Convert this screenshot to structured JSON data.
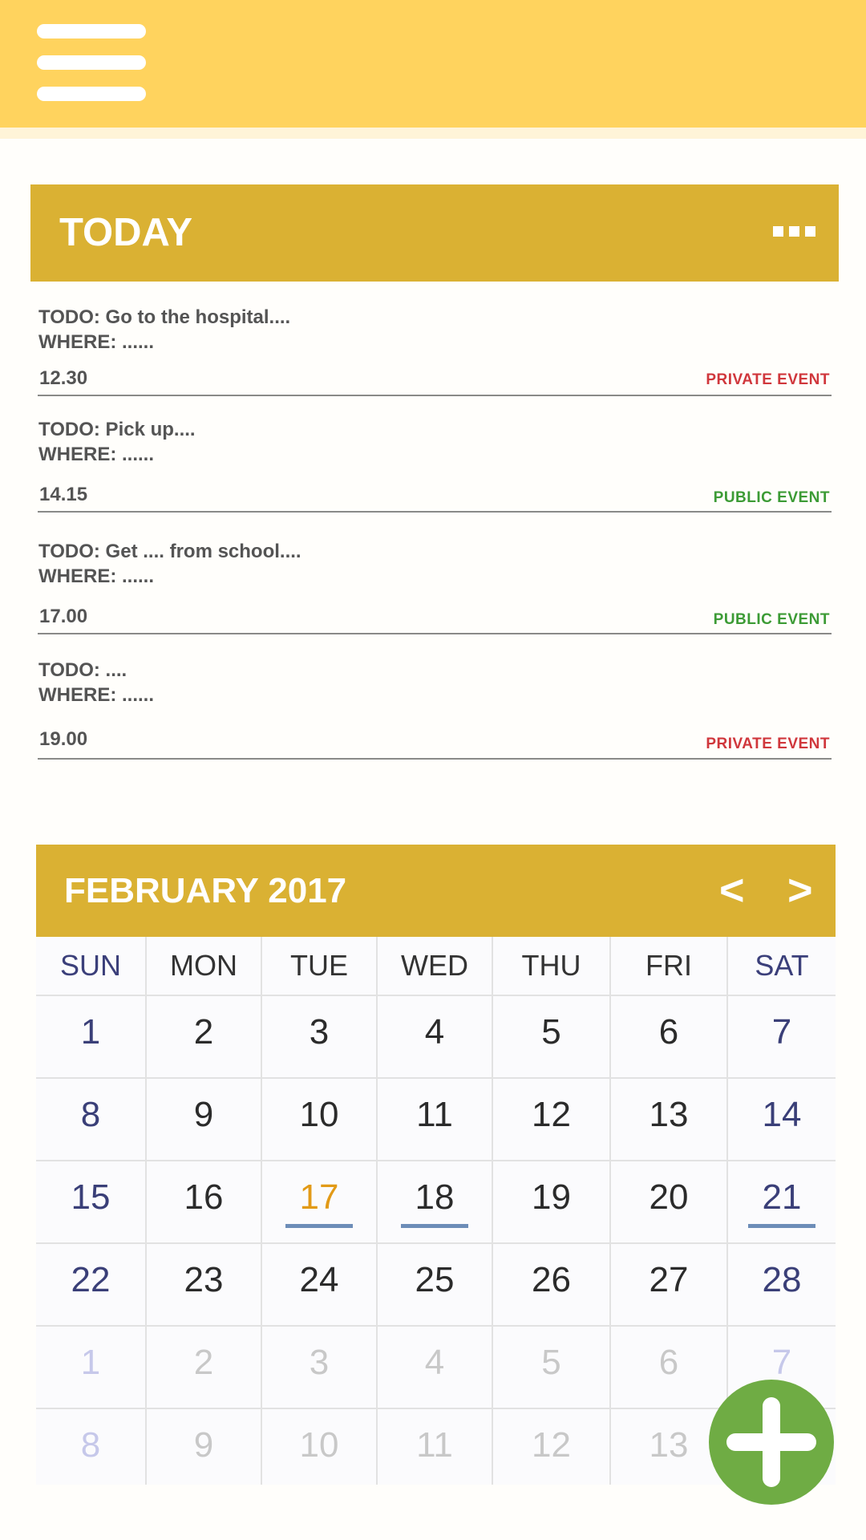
{
  "app": {
    "menu_icon": "hamburger-menu-icon"
  },
  "today": {
    "title": "TODAY",
    "more_icon": "more-options-icon",
    "events": [
      {
        "todo": "TODO: Go to the hospital....",
        "where": "WHERE: ......",
        "time": "12.30",
        "type": "PRIVATE EVENT",
        "type_color": "#d0373c"
      },
      {
        "todo": "TODO: Pick up....",
        "where": "WHERE: ......",
        "time": "14.15",
        "type": "PUBLIC EVENT",
        "type_color": "#3c9b35"
      },
      {
        "todo": "TODO: Get .... from school....",
        "where": "WHERE: ......",
        "time": "17.00",
        "type": "PUBLIC EVENT",
        "type_color": "#3c9b35"
      },
      {
        "todo": "TODO: ....",
        "where": "WHERE: ......",
        "time": "19.00",
        "type": "PRIVATE EVENT",
        "type_color": "#d0373c"
      }
    ]
  },
  "calendar": {
    "month_label": "FEBRUARY 2017",
    "prev_label": "<",
    "next_label": ">",
    "weekdays": [
      "SUN",
      "MON",
      "TUE",
      "WED",
      "THU",
      "FRI",
      "SAT"
    ],
    "weeks": [
      [
        "1",
        "2",
        "3",
        "4",
        "5",
        "6",
        "7"
      ],
      [
        "8",
        "9",
        "10",
        "11",
        "12",
        "13",
        "14"
      ],
      [
        "15",
        "16",
        "17",
        "18",
        "19",
        "20",
        "21"
      ],
      [
        "22",
        "23",
        "24",
        "25",
        "26",
        "27",
        "28"
      ],
      [
        "1",
        "2",
        "3",
        "4",
        "5",
        "6",
        "7"
      ],
      [
        "8",
        "9",
        "10",
        "11",
        "12",
        "13",
        ""
      ]
    ],
    "today_day": "17",
    "days_with_events": [
      "17",
      "18",
      "21"
    ],
    "colors": {
      "header": "#dab133",
      "today": "#e29a17",
      "event_marker": "#6d8db8"
    }
  },
  "fab": {
    "icon": "plus-icon",
    "color": "#6fac44"
  },
  "colors": {
    "top_bar": "#ffd35e",
    "private_event": "#d0373c",
    "public_event": "#3c9b35"
  }
}
